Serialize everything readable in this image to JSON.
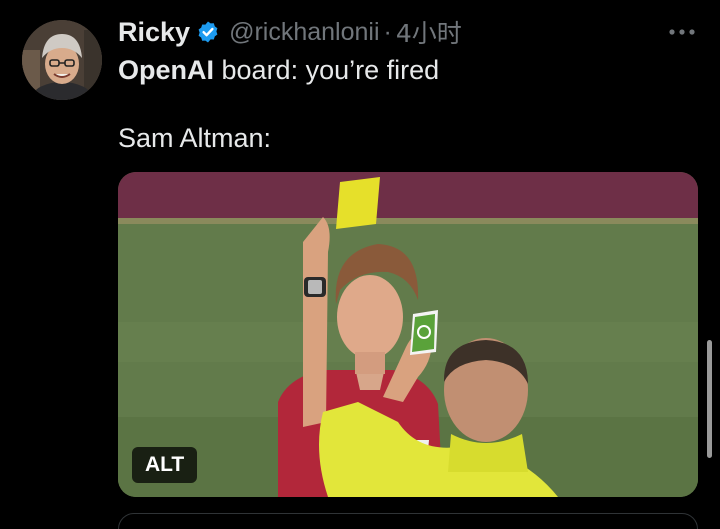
{
  "tweet": {
    "display_name": "Ricky",
    "handle": "@rickhanlonii",
    "separator": "·",
    "timestamp": "4小时",
    "text_bold": "OpenAI",
    "text_line1_rest": " board: you’re fired",
    "text_line2": "Sam Altman:",
    "alt_label": "ALT",
    "icons": {
      "verified": "verified-badge-icon",
      "more": "more-options-icon"
    }
  },
  "colors": {
    "background": "#000000",
    "primary_text": "#e7e9ea",
    "secondary_text": "#71767b",
    "verified_blue": "#1d9bf0"
  }
}
